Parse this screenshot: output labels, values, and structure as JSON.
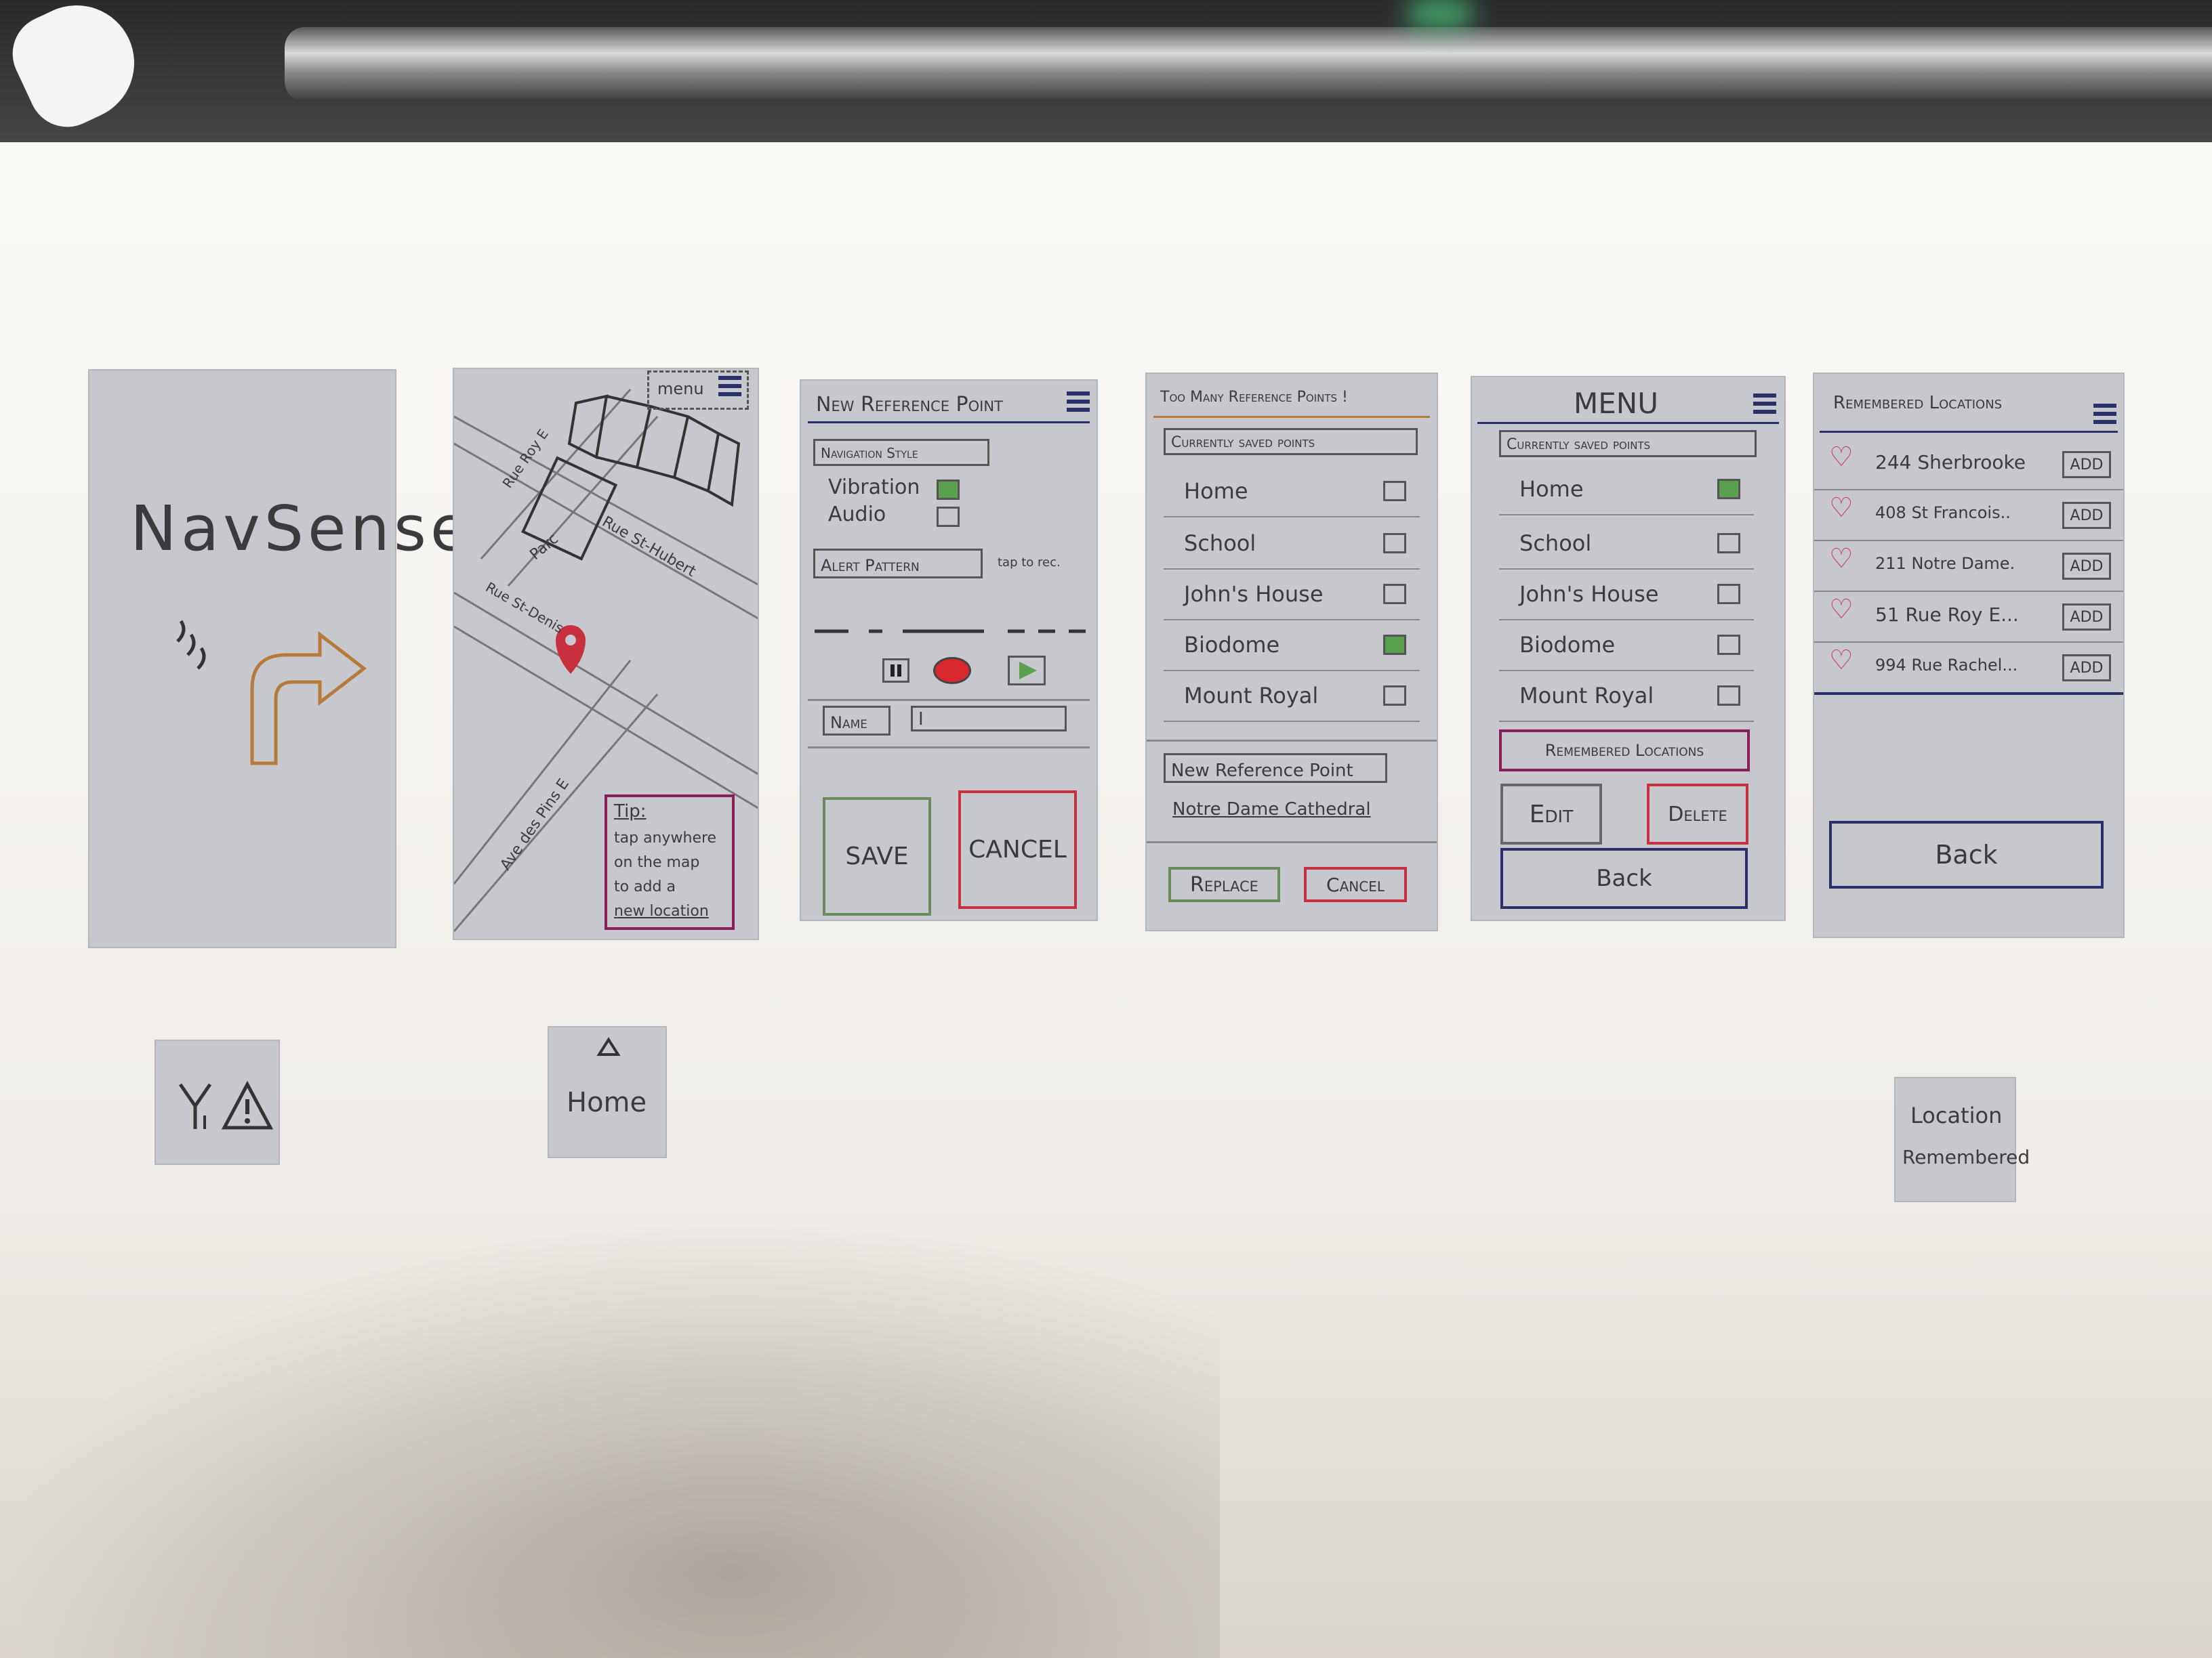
{
  "splash": {
    "title": "NavSense"
  },
  "map": {
    "menu_label": "menu",
    "streets": [
      "Rue Roy E",
      "Rue St-Hubert",
      "Rue St-Denis",
      "Ave des Pins E"
    ],
    "park_label": "Parc",
    "tip_title": "Tip:",
    "tip_lines": [
      "tap anywhere",
      "on the map",
      "to add a",
      "new location"
    ]
  },
  "new_ref": {
    "title": "New Reference Point",
    "nav_style_label": "Navigation Style",
    "vibration_label": "Vibration",
    "audio_label": "Audio",
    "alert_pattern_label": "Alert Pattern",
    "tap_to_rec": "tap to rec.",
    "name_label": "Name",
    "name_value": "I",
    "save_label": "SAVE",
    "cancel_label": "CANCEL"
  },
  "too_many": {
    "title": "Too Many Reference Points !",
    "section_label": "Currently saved points",
    "items": [
      {
        "label": "Home",
        "checked": false
      },
      {
        "label": "School",
        "checked": false
      },
      {
        "label": "John's House",
        "checked": false
      },
      {
        "label": "Biodome",
        "checked": true
      },
      {
        "label": "Mount Royal",
        "checked": false
      }
    ],
    "new_ref_label": "New Reference Point",
    "new_ref_value": "Notre Dame Cathedral",
    "replace_label": "Replace",
    "cancel_label": "Cancel"
  },
  "menu": {
    "title": "MENU",
    "section_label": "Currently saved points",
    "items": [
      {
        "label": "Home",
        "checked": true
      },
      {
        "label": "School",
        "checked": false
      },
      {
        "label": "John's House",
        "checked": false
      },
      {
        "label": "Biodome",
        "checked": false
      },
      {
        "label": "Mount Royal",
        "checked": false
      }
    ],
    "remembered_label": "Remembered Locations",
    "edit_label": "Edit",
    "delete_label": "Delete",
    "back_label": "Back"
  },
  "remembered": {
    "title": "Remembered Locations",
    "items": [
      {
        "label": "244 Sherbrooke",
        "add": "ADD"
      },
      {
        "label": "408 St Francois..",
        "add": "ADD"
      },
      {
        "label": "211 Notre Dame.",
        "add": "ADD"
      },
      {
        "label": "51 Rue Roy E...",
        "add": "ADD"
      },
      {
        "label": "994 Rue Rachel...",
        "add": "ADD"
      }
    ],
    "back_label": "Back"
  },
  "popups": {
    "home_label": "Home",
    "location_line1": "Location",
    "location_line2": "Remembered"
  },
  "colors": {
    "card": "#c6c8cd",
    "accent_red": "#c8303e",
    "accent_green": "#6a8c5a",
    "accent_navy": "#2b2f6a",
    "check_on": "#5aa04e"
  }
}
